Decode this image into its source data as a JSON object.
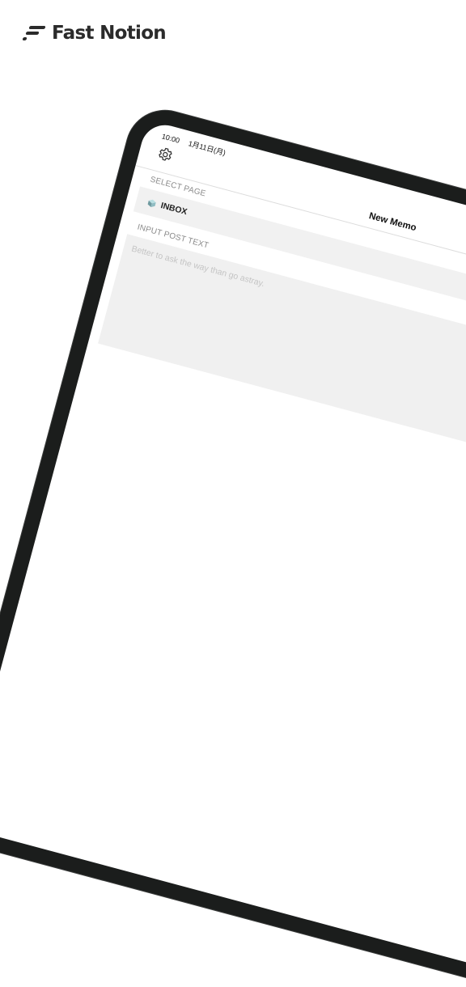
{
  "brand": {
    "name": "Fast Notion",
    "logo_icon": "fast-notion-logo"
  },
  "status_bar": {
    "time": "10:00",
    "date": "1月11日(月)"
  },
  "header": {
    "title": "New Memo",
    "settings_icon": "gear-icon"
  },
  "select_page": {
    "label": "SELECT PAGE",
    "selected_page": "INBOX",
    "page_icon": "cube-icon"
  },
  "post_text": {
    "label": "INPUT POST TEXT",
    "placeholder": "Better to ask the way than go astray."
  }
}
